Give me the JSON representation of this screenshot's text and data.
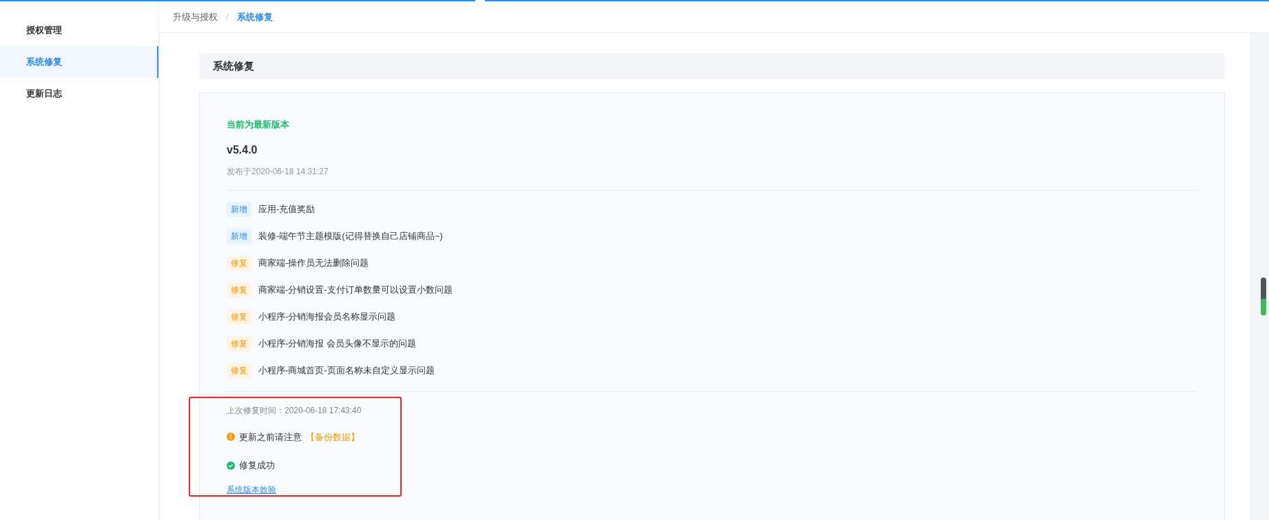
{
  "sidebar": {
    "items": [
      {
        "label": "授权管理",
        "selected": false
      },
      {
        "label": "系统修复",
        "selected": true
      },
      {
        "label": "更新日志",
        "selected": false
      }
    ]
  },
  "breadcrumb": [
    {
      "label": "升级与授权",
      "current": false
    },
    {
      "label": "系统修复",
      "current": true
    }
  ],
  "breadcrumb_separator": "/",
  "panel_title": "系统修复",
  "version_status": "当前为最新版本",
  "version": "v5.4.0",
  "release_time": "发布于2020-06-18 14:31:27",
  "changes": [
    {
      "kind": "new",
      "tag": "新增",
      "text": "应用-充值奖励"
    },
    {
      "kind": "new",
      "tag": "新增",
      "text": "装修-端午节主题模版(记得替换自己店铺商品~)"
    },
    {
      "kind": "fix",
      "tag": "修复",
      "text": "商家端-操作员无法删除问题"
    },
    {
      "kind": "fix",
      "tag": "修复",
      "text": "商家端-分销设置-支付订单数量可以设置小数问题"
    },
    {
      "kind": "fix",
      "tag": "修复",
      "text": "小程序-分销海报会员名称显示问题"
    },
    {
      "kind": "fix",
      "tag": "修复",
      "text": "小程序-分销海报 会员头像不显示的问题"
    },
    {
      "kind": "fix",
      "tag": "修复",
      "text": "小程序-商城首页-页面名称未自定义显示问题"
    }
  ],
  "last_repair": "上次修复时间：2020-06-18 17:43:40",
  "notices": [
    {
      "kind": "warning",
      "text": "更新之前请注意",
      "highlight": "【备份数据】"
    },
    {
      "kind": "success",
      "text": "修复成功"
    }
  ],
  "check_link": "系统版本效验"
}
